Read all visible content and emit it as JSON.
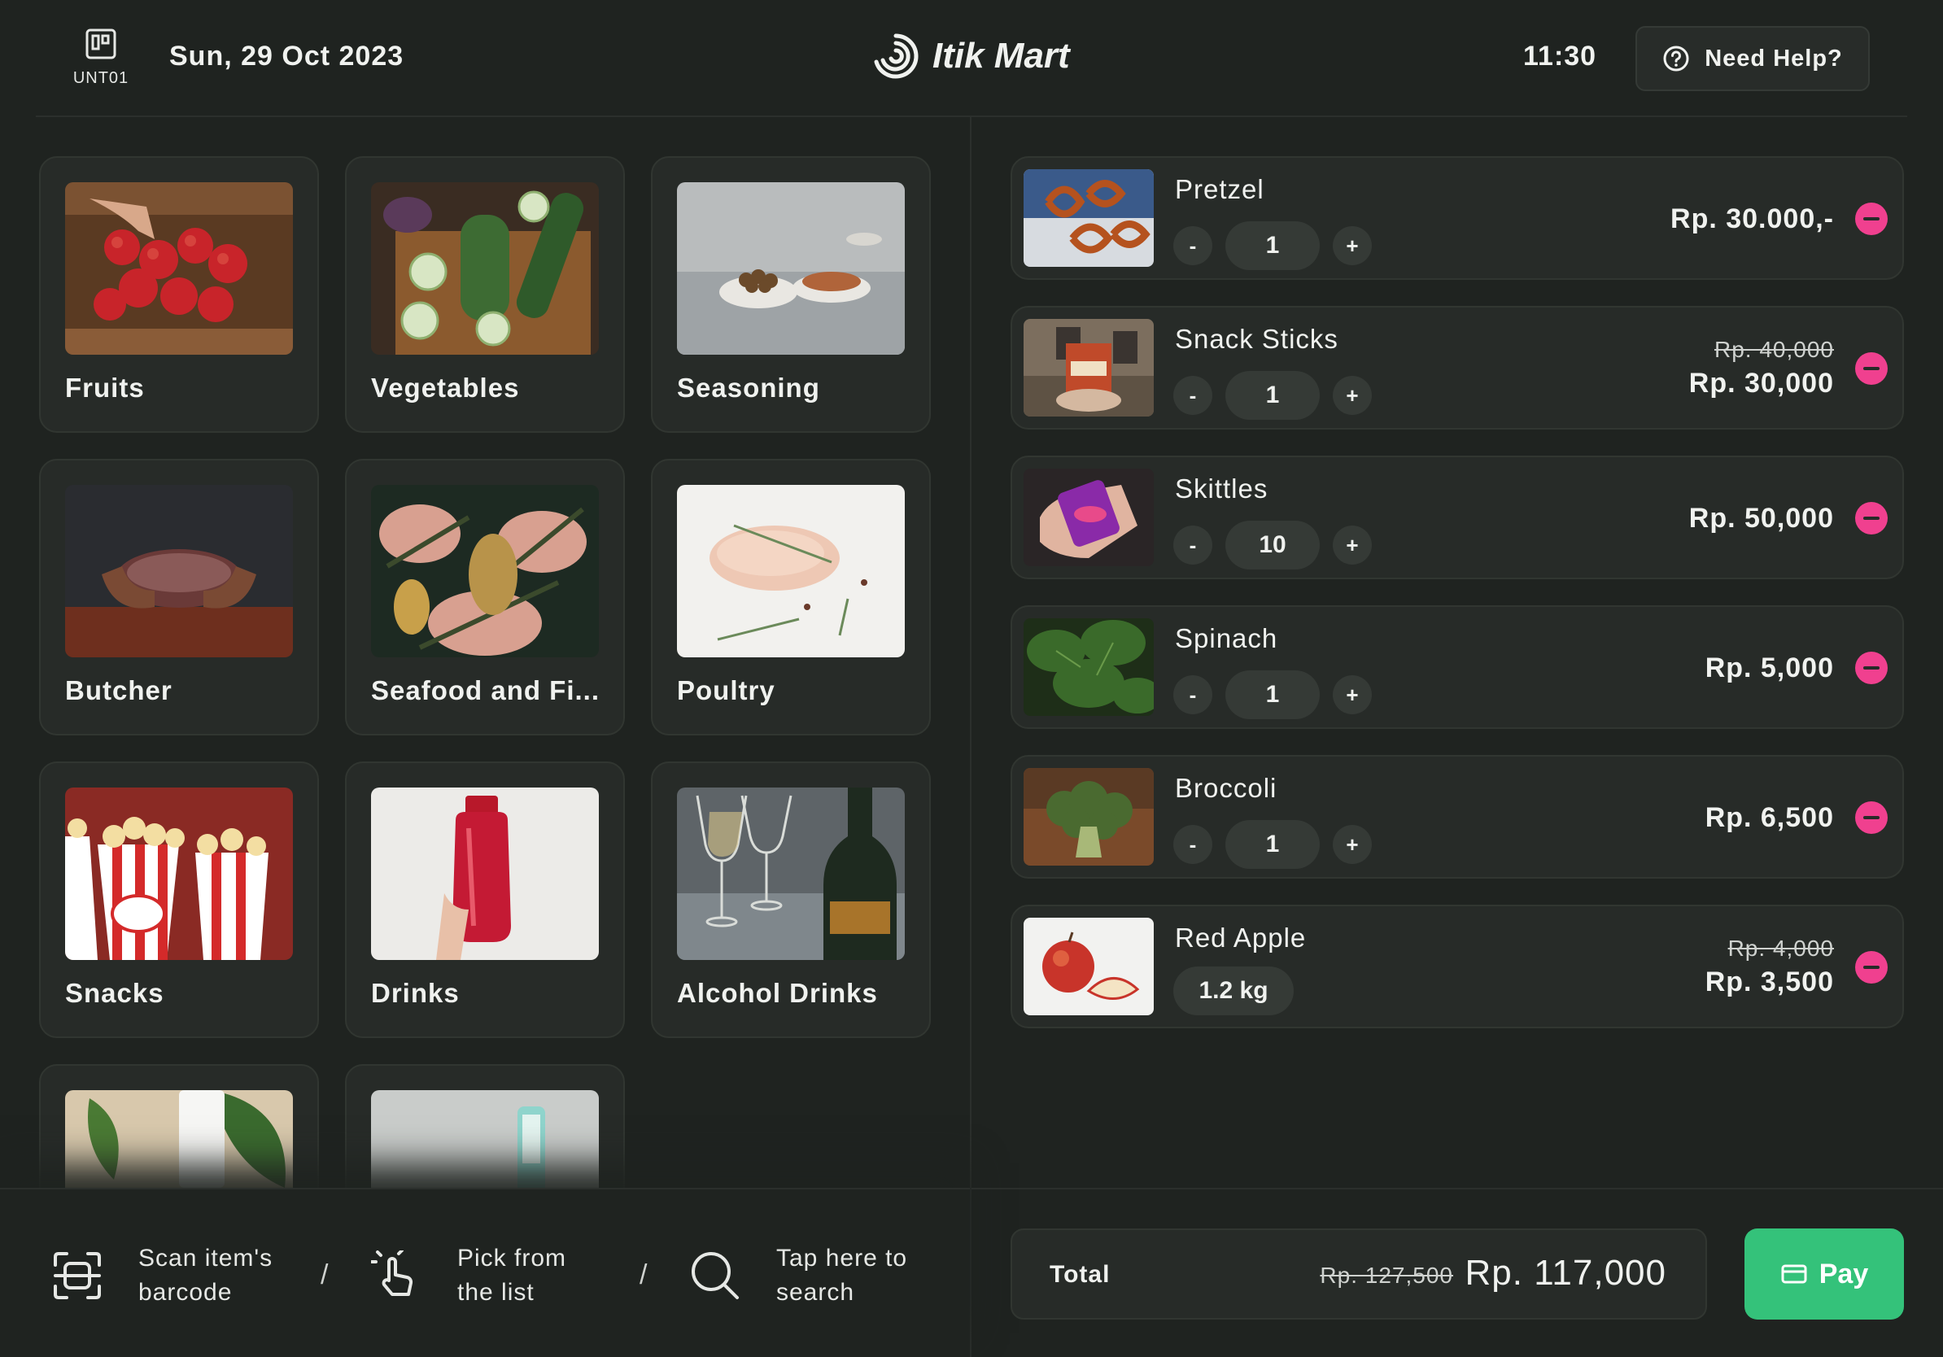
{
  "header": {
    "unit_label": "UNT01",
    "date": "Sun, 29 Oct 2023",
    "brand": "Itik Mart",
    "time": "11:30",
    "help_label": "Need Help?"
  },
  "categories": [
    {
      "label": "Fruits",
      "icon": "fruits-photo"
    },
    {
      "label": "Vegetables",
      "icon": "vegetables-photo"
    },
    {
      "label": "Seasoning",
      "icon": "seasoning-photo"
    },
    {
      "label": "Butcher",
      "icon": "butcher-photo"
    },
    {
      "label": "Seafood and Fi...",
      "icon": "seafood-photo"
    },
    {
      "label": "Poultry",
      "icon": "poultry-photo"
    },
    {
      "label": "Snacks",
      "icon": "snacks-photo"
    },
    {
      "label": "Drinks",
      "icon": "drinks-photo"
    },
    {
      "label": "Alcohol Drinks",
      "icon": "alcohol-photo"
    },
    {
      "label": "",
      "icon": "skincare-photo"
    },
    {
      "label": "",
      "icon": "personal-care-photo"
    }
  ],
  "hints": {
    "scan": "Scan item's barcode",
    "pick": "Pick from the list",
    "search": "Tap here to search",
    "separator": "/"
  },
  "cart": {
    "items": [
      {
        "name": "Pretzel",
        "qty": "1",
        "price": "Rp. 30.000,-",
        "old_price": ""
      },
      {
        "name": "Snack Sticks",
        "qty": "1",
        "price": "Rp. 30,000",
        "old_price": "Rp. 40,000"
      },
      {
        "name": "Skittles",
        "qty": "10",
        "price": "Rp. 50,000",
        "old_price": ""
      },
      {
        "name": "Spinach",
        "qty": "1",
        "price": "Rp. 5,000",
        "old_price": ""
      },
      {
        "name": "Broccoli",
        "qty": "1",
        "price": "Rp. 6,500",
        "old_price": ""
      },
      {
        "name": "Red Apple",
        "weight": "1.2 kg",
        "price": "Rp. 3,500",
        "old_price": "Rp. 4,000"
      }
    ],
    "minus": "-",
    "plus": "+"
  },
  "totals": {
    "label": "Total",
    "old_total": "Rp. 127,500",
    "total": "Rp. 117,000",
    "pay_label": "Pay"
  },
  "colors": {
    "background": "#1f2320",
    "card": "#272b28",
    "remove_accent": "#f0408f",
    "pay_green": "#34c27a"
  }
}
